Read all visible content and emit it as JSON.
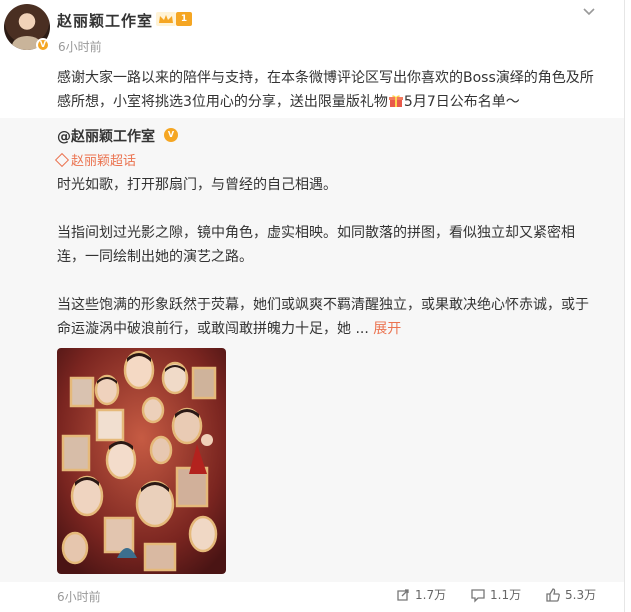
{
  "post": {
    "author": "赵丽颖工作室",
    "level_badge": "1",
    "time": "6小时前",
    "text": "感谢大家一路以来的陪伴与支持，在本条微博评论区写出你喜欢的Boss演绎的角色及所感所想，小室将挑选3位用心的分享，送出限量版礼物",
    "text_after_gift": "5月7日公布名单～"
  },
  "repost": {
    "author": "@赵丽颖工作室",
    "super_topic": "赵丽颖超话",
    "paragraphs": [
      "时光如歌，打开那扇门，与曾经的自己相遇。",
      "当指间划过光影之隙，镜中角色，虚实相映。如同散落的拼图，看似独立却又紧密相连，一同绘制出她的演艺之路。",
      "当这些饱满的形象跃然于荧幕，她们或飒爽不羁清醒独立，或果敢决绝心怀赤诚，或于命运漩涡中破浪前行，或敢闯敢拼魄力十足，她 ..."
    ],
    "expand_label": "展开"
  },
  "footer": {
    "time": "6小时前",
    "reposts": "1.7万",
    "comments": "1.1万",
    "likes": "5.3万"
  },
  "colors": {
    "accent": "#eb7350",
    "badge": "#f5a623",
    "repost_bg": "#f7f7f7",
    "muted": "#999999"
  },
  "icons": [
    "chevron-down-icon",
    "crown-icon",
    "verified-icon",
    "gift-icon",
    "super-topic-icon",
    "repost-icon",
    "comment-icon",
    "like-icon"
  ]
}
